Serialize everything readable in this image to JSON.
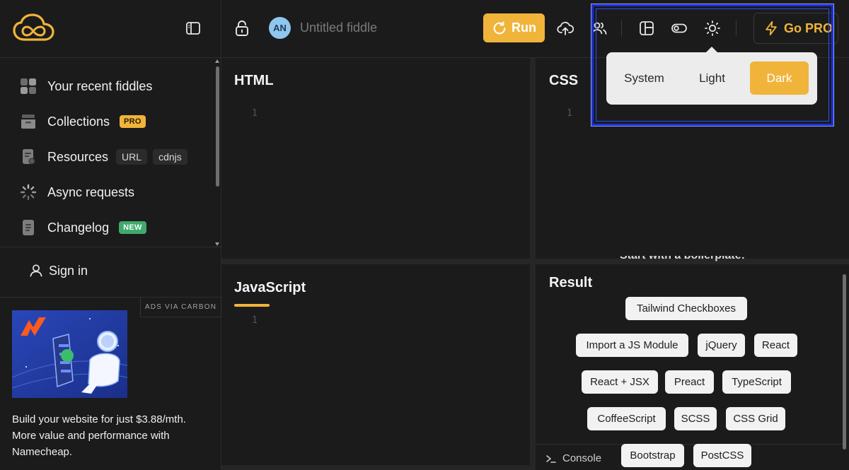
{
  "sidebar": {
    "items": [
      {
        "label": "Your recent fiddles",
        "icon": "grid-icon"
      },
      {
        "label": "Collections",
        "icon": "box-icon",
        "badge": "PRO"
      },
      {
        "label": "Resources",
        "icon": "file-icon",
        "chips": [
          "URL",
          "cdnjs"
        ]
      },
      {
        "label": "Async requests",
        "icon": "spinner-icon"
      },
      {
        "label": "Changelog",
        "icon": "document-icon",
        "badge": "NEW"
      }
    ],
    "sign_in": "Sign in",
    "ads_via": "ADS VIA CARBON",
    "ad_text": "Build your website for just $3.88/mth. More value and performance with Namecheap."
  },
  "header": {
    "avatar_initials": "AN",
    "title": "Untitled fiddle",
    "run_label": "Run",
    "go_pro_label": "Go PRO"
  },
  "theme_menu": {
    "options": [
      "System",
      "Light",
      "Dark"
    ],
    "selected": "Dark"
  },
  "panels": {
    "html_title": "HTML",
    "css_title": "CSS",
    "js_title": "JavaScript",
    "result_title": "Result",
    "line_number": "1"
  },
  "result": {
    "boilerplate_heading": "Start with a boilerplate:",
    "templates": [
      "Tailwind Checkboxes",
      "Import a JS Module",
      "jQuery",
      "React",
      "React + JSX",
      "Preact",
      "TypeScript",
      "CoffeeScript",
      "SCSS",
      "CSS Grid",
      "Bootstrap",
      "PostCSS"
    ],
    "console_label": "Console"
  },
  "colors": {
    "accent": "#f0b43a",
    "background": "#1b1b1b",
    "highlight": "#1a2fd6"
  }
}
